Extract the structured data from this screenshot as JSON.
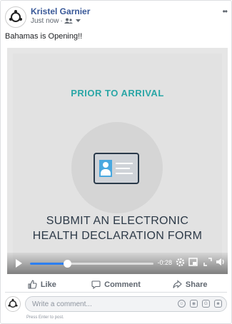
{
  "post": {
    "author": "Kristel Garnier",
    "timestamp": "Just now",
    "audience_icon": "friends-icon",
    "text": "Bahamas is Opening!!"
  },
  "video": {
    "heading": "PRIOR TO ARRIVAL",
    "line1": "SUBMIT AN ELECTRONIC",
    "line2": "HEALTH DECLARATION FORM",
    "time_remaining": "-0:28",
    "progress": 0.3,
    "colors": {
      "heading": "#2aa6a6",
      "progress": "#2c7ff0",
      "id_photo": "#49a8e0"
    }
  },
  "actions": {
    "like": "Like",
    "comment": "Comment",
    "share": "Share"
  },
  "comment_box": {
    "placeholder": "Write a comment...",
    "hint": "Press Enter to post."
  }
}
